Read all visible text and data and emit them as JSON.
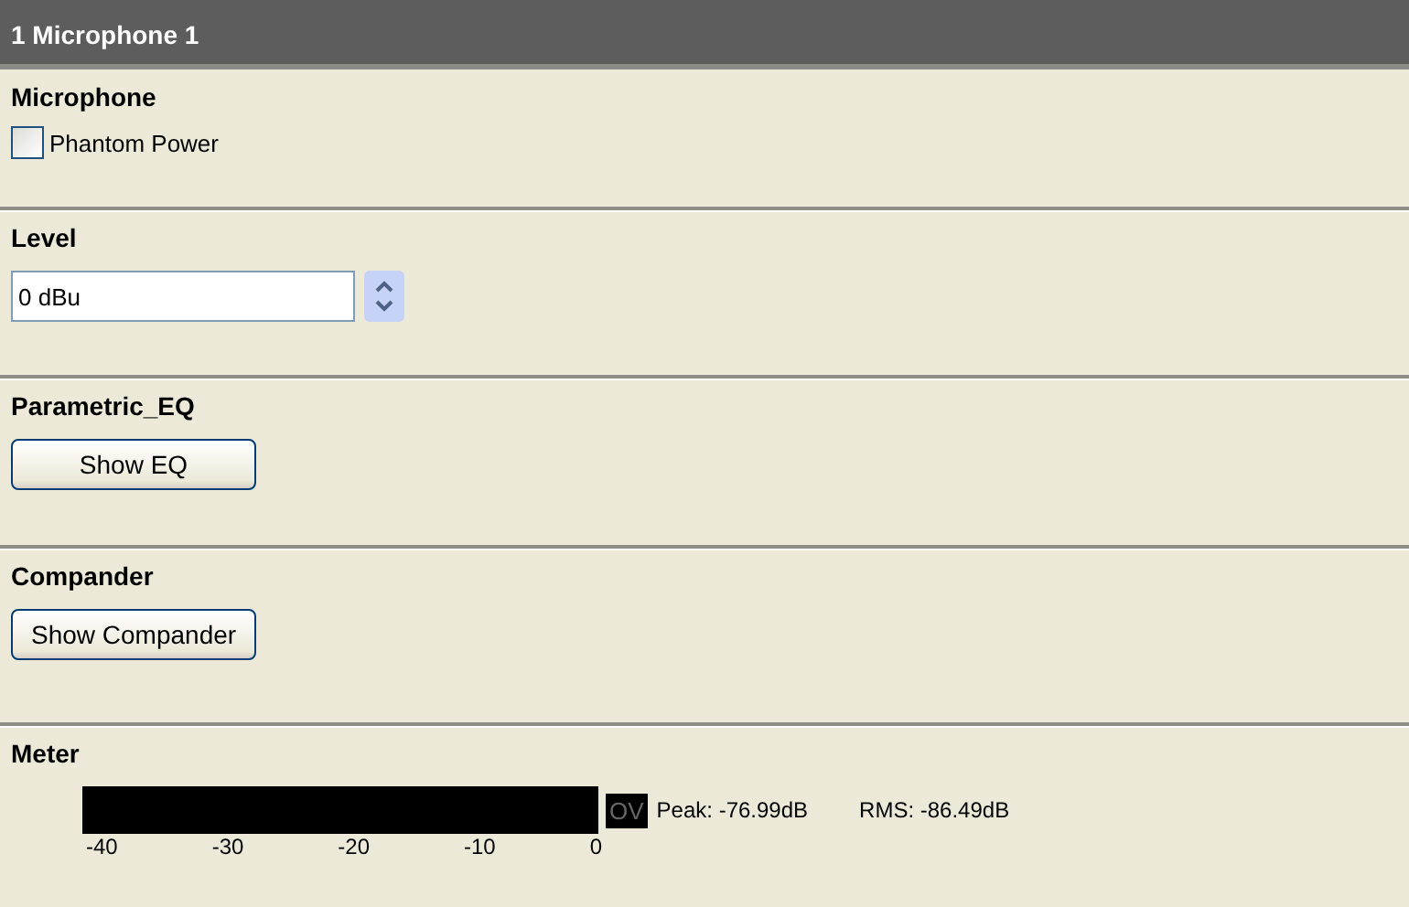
{
  "title": "1 Microphone 1",
  "sections": [
    {
      "kind": "checkbox",
      "heading": "Microphone",
      "label": "Phantom Power",
      "checked": false
    },
    {
      "kind": "spinner",
      "heading": "Level",
      "value": "0 dBu"
    },
    {
      "kind": "button",
      "heading": "Parametric_EQ",
      "button": "Show EQ"
    },
    {
      "kind": "button",
      "heading": "Compander",
      "button": "Show Compander"
    },
    {
      "kind": "meter",
      "heading": "Meter",
      "overload": {
        "label": "OV",
        "on": false
      },
      "peak": "Peak: -76.99dB",
      "rms": "RMS: -86.49dB",
      "ticks": [
        "-40",
        "-30",
        "-20",
        "-10",
        "0"
      ]
    }
  ]
}
